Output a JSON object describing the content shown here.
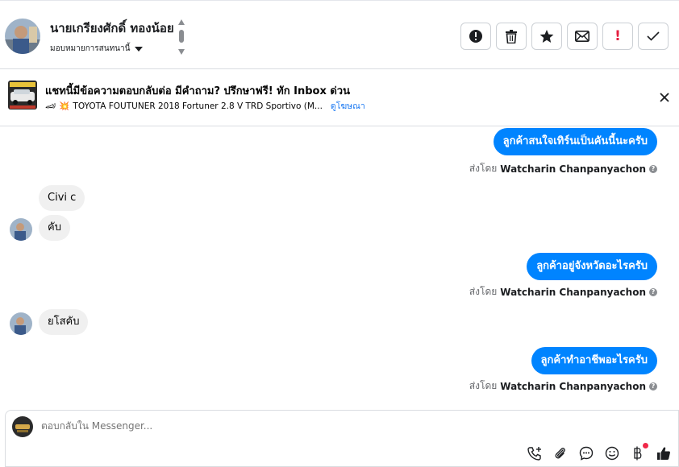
{
  "header": {
    "contact_name": "นายเกรียงศักดิ์ ทองน้อย",
    "assign_label": "มอบหมายการสนทนานี้",
    "actions": [
      {
        "name": "report-spam",
        "icon": "exclamation-circle-icon"
      },
      {
        "name": "delete",
        "icon": "trash-icon"
      },
      {
        "name": "star",
        "icon": "star-icon"
      },
      {
        "name": "mark-unread",
        "icon": "envelope-icon"
      },
      {
        "name": "follow-up",
        "icon": "exclamation-icon",
        "label": "!"
      },
      {
        "name": "mark-done",
        "icon": "check-icon"
      }
    ]
  },
  "ad": {
    "title": "แชทนี้มีข้อความตอบกลับต่อ มีคำถาม? ปรึกษาฟรี! ทัก Inbox ด่วน",
    "subtitle": "TOYOTA FOUTUNER 2018 Fortuner 2.8 V TRD Sportivo (M...",
    "link": "ดูโฆษณา",
    "emoji": [
      "🏎",
      "💥"
    ]
  },
  "thread": {
    "messages": [
      {
        "dir": "out",
        "text": "ลูกค้าสนใจเทิร์นเป็นคันนี้นะครับ",
        "sent_prefix": "ส่งโดย",
        "sender": "Watcharin Chanpanyachon"
      },
      {
        "dir": "in",
        "text": "Civi c"
      },
      {
        "dir": "in",
        "text": "คับ"
      },
      {
        "dir": "out",
        "text": "ลูกค้าอยู่จังหวัดอะไรครับ",
        "sent_prefix": "ส่งโดย",
        "sender": "Watcharin Chanpanyachon"
      },
      {
        "dir": "in",
        "text": "ยโสคับ"
      },
      {
        "dir": "out",
        "text": "ลูกค้าทำอาชีพอะไรครับ",
        "sent_prefix": "ส่งโดย",
        "sender": "Watcharin Chanpanyachon"
      }
    ]
  },
  "composer": {
    "placeholder": "ตอบกลับใน Messenger...",
    "tools": [
      "call-add-icon",
      "paperclip-icon",
      "saved-reply-icon",
      "emoji-icon",
      "baht-icon",
      "thumbs-up-icon"
    ]
  },
  "colors": {
    "accent": "#0084ff",
    "incoming_bubble": "#f0f0f0",
    "alert_red": "#e41e3f",
    "link": "#1877f2"
  }
}
